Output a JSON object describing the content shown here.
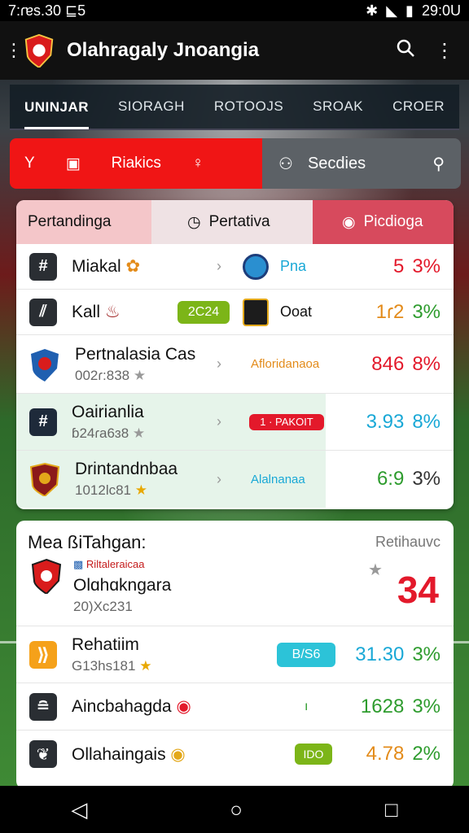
{
  "status": {
    "left": "7:ɾɐs.30 ⊑5",
    "time": "29:0U"
  },
  "appbar": {
    "title": "Olahragaly Jnoangia"
  },
  "tabs": [
    "UNINJAR",
    "SIORAGH",
    "ROTOOJS",
    "SROAK",
    "CROER"
  ],
  "filter": {
    "red_label": "Riakics",
    "gray_label": "Secdies"
  },
  "card": {
    "headers": [
      "Pertandinga",
      "Pertativa",
      "Picdioga"
    ],
    "rows": [
      {
        "name": "Miakal",
        "sub": "",
        "team": "Pna",
        "value": "5",
        "pct": "3%",
        "color": "#e3192b"
      },
      {
        "name": "Kall",
        "sub": "",
        "badge": "2C24",
        "team": "Ooat",
        "value": "1ɾ2",
        "pct": "3%",
        "color": "#e38b1a"
      },
      {
        "name": "Pertnalasia Cas",
        "sub": "002ɾ:838",
        "team": "Afloridanaoa",
        "value": "846",
        "pct": "8%",
        "color": "#e3192b"
      },
      {
        "name": "Oairianlia",
        "sub": "ɓ24ɾa6ɜ8",
        "team": "1 · PAKOIT",
        "value": "3.93",
        "pct": "8%",
        "color": "#19a8d6"
      },
      {
        "name": "Drintandnbaa",
        "sub": "1012lc81",
        "team": "Alalnanaa",
        "value": "6:9",
        "pct": "3%",
        "color": "#2e9c2e"
      }
    ]
  },
  "card2": {
    "title": "Mea ßiTahgan:",
    "right_label": "Retihauvc",
    "big_value": "34",
    "feature": {
      "tag": "Riltaleraicaa",
      "name": "Olɑhɑkngara",
      "sub": "20)Xc231"
    },
    "rows": [
      {
        "name": "Rehatiim",
        "sub": "G13hs181",
        "badge": "B/S6",
        "value": "31.30",
        "pct": "3%",
        "color": "#19a8d6"
      },
      {
        "name": "Aincbahagda",
        "sub": "",
        "value": "1628",
        "pct": "3%",
        "color": "#2e9c2e"
      },
      {
        "name": "Ollahaingais",
        "sub": "",
        "badge": "IDO",
        "value": "4.78",
        "pct": "2%",
        "color": "#e38b1a"
      }
    ]
  }
}
